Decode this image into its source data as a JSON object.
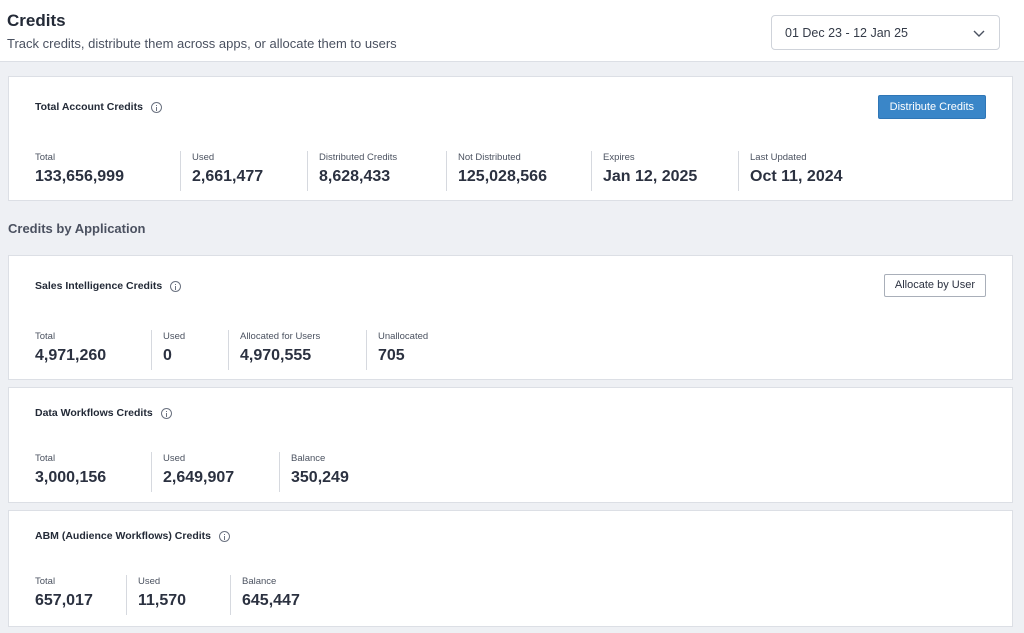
{
  "header": {
    "title": "Credits",
    "subtitle": "Track credits, distribute them across apps, or allocate them to users",
    "date_range": "01 Dec 23 - 12 Jan 25"
  },
  "account": {
    "title": "Total Account Credits",
    "button": "Distribute Credits",
    "stats": [
      {
        "label": "Total",
        "value": "133,656,999"
      },
      {
        "label": "Used",
        "value": "2,661,477"
      },
      {
        "label": "Distributed Credits",
        "value": "8,628,433"
      },
      {
        "label": "Not Distributed",
        "value": "125,028,566"
      },
      {
        "label": "Expires",
        "value": "Jan 12, 2025"
      },
      {
        "label": "Last Updated",
        "value": "Oct 11, 2024"
      }
    ]
  },
  "section_heading": "Credits by Application",
  "sales": {
    "title": "Sales Intelligence Credits",
    "button": "Allocate by User",
    "stats": [
      {
        "label": "Total",
        "value": "4,971,260"
      },
      {
        "label": "Used",
        "value": "0"
      },
      {
        "label": "Allocated for Users",
        "value": "4,970,555"
      },
      {
        "label": "Unallocated",
        "value": "705"
      }
    ]
  },
  "workflows": {
    "title": "Data Workflows Credits",
    "stats": [
      {
        "label": "Total",
        "value": "3,000,156"
      },
      {
        "label": "Used",
        "value": "2,649,907"
      },
      {
        "label": "Balance",
        "value": "350,249"
      }
    ]
  },
  "abm": {
    "title": "ABM (Audience Workflows) Credits",
    "stats": [
      {
        "label": "Total",
        "value": "657,017"
      },
      {
        "label": "Used",
        "value": "11,570"
      },
      {
        "label": "Balance",
        "value": "645,447"
      }
    ]
  },
  "colors": {
    "primary": "#3a86c8",
    "background": "#eef0f4",
    "card": "#ffffff"
  }
}
